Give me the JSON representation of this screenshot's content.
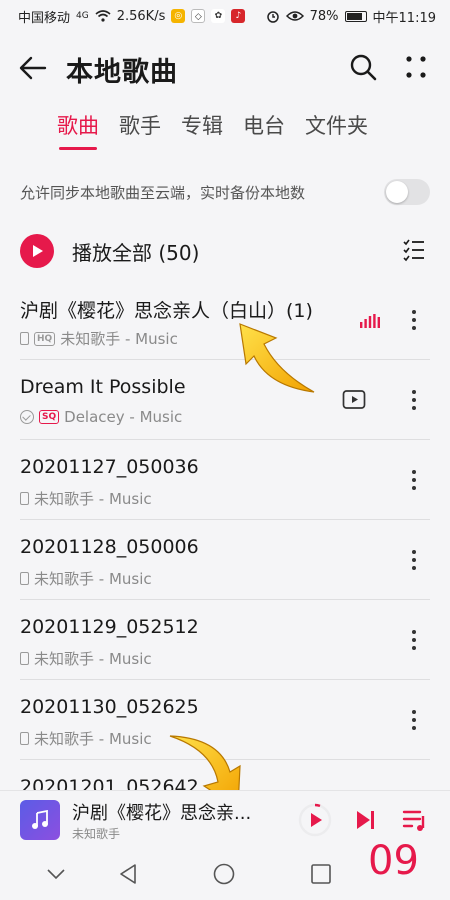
{
  "status_bar": {
    "carrier": "中国移动",
    "network": "4G",
    "speed": "2.56K/s",
    "battery": "78%",
    "time": "中午11:19"
  },
  "header": {
    "title": "本地歌曲"
  },
  "tabs": [
    {
      "label": "歌曲",
      "active": true
    },
    {
      "label": "歌手",
      "active": false
    },
    {
      "label": "专辑",
      "active": false
    },
    {
      "label": "电台",
      "active": false
    },
    {
      "label": "文件夹",
      "active": false
    }
  ],
  "sync": {
    "text": "允许同步本地歌曲至云端，实时备份本地数",
    "enabled": false
  },
  "play_all": {
    "label": "播放全部 (50)"
  },
  "songs": [
    {
      "title": "沪剧《樱花》思念亲人（白山）(1)",
      "badge": "HQ",
      "subtitle": "未知歌手 - Music",
      "playing": true
    },
    {
      "title": "Dream It Possible",
      "badge": "SQ",
      "subtitle": "Delacey - Music",
      "has_mv": true
    },
    {
      "title": "20201127_050036",
      "subtitle": "未知歌手 - Music"
    },
    {
      "title": "20201128_050006",
      "subtitle": "未知歌手 - Music"
    },
    {
      "title": "20201129_052512",
      "subtitle": "未知歌手 - Music"
    },
    {
      "title": "20201130_052625",
      "subtitle": "未知歌手 - Music"
    },
    {
      "title": "20201201_052642",
      "subtitle": ""
    }
  ],
  "mini_player": {
    "title": "沪剧《樱花》思念亲...",
    "artist": "未知歌手"
  },
  "overlay": {
    "step": "09"
  },
  "colors": {
    "accent": "#e6194b",
    "background": "#f5f5f7"
  }
}
